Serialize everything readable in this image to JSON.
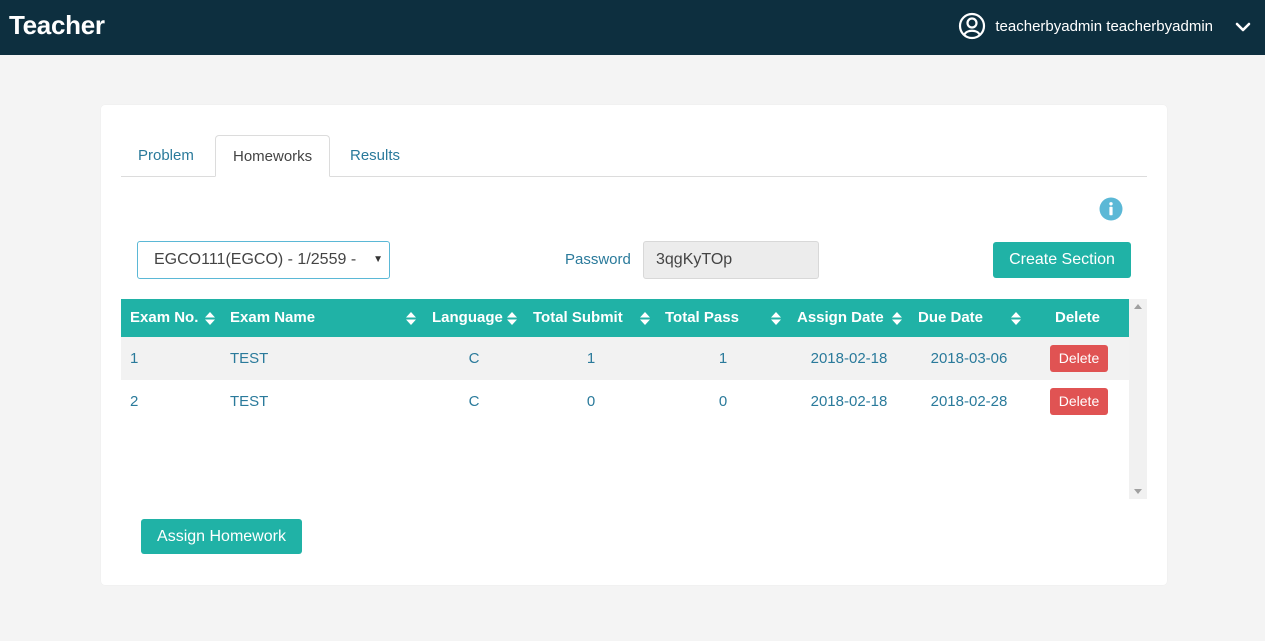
{
  "header": {
    "brand": "Teacher",
    "user_name": "teacherbyadmin teacherbyadmin",
    "user_icon": "user-circle-icon",
    "menu_icon": "chevron-down-icon"
  },
  "tabs": [
    {
      "label": "Problem",
      "active": false
    },
    {
      "label": "Homeworks",
      "active": true
    },
    {
      "label": "Results",
      "active": false
    }
  ],
  "section_select": {
    "value": "EGCO111(EGCO) - 1/2559 -"
  },
  "password": {
    "label": "Password",
    "value": "3qgKyTOp"
  },
  "buttons": {
    "create_section": "Create Section",
    "assign_homework": "Assign Homework"
  },
  "table": {
    "columns": [
      "Exam No.",
      "Exam Name",
      "Language",
      "Total Submit",
      "Total Pass",
      "Assign Date",
      "Due Date",
      "Delete"
    ],
    "rows": [
      {
        "exam_no": "1",
        "exam_name": "TEST",
        "language": "C",
        "total_submit": "1",
        "total_pass": "1",
        "assign_date": "2018-02-18",
        "due_date": "2018-03-06",
        "action": "Delete"
      },
      {
        "exam_no": "2",
        "exam_name": "TEST",
        "language": "C",
        "total_submit": "0",
        "total_pass": "0",
        "assign_date": "2018-02-18",
        "due_date": "2018-02-28",
        "action": "Delete"
      }
    ]
  },
  "colors": {
    "navbar": "#0d2f3f",
    "accent": "#20b2a6",
    "danger": "#e05353",
    "link": "#2a7a9b"
  }
}
